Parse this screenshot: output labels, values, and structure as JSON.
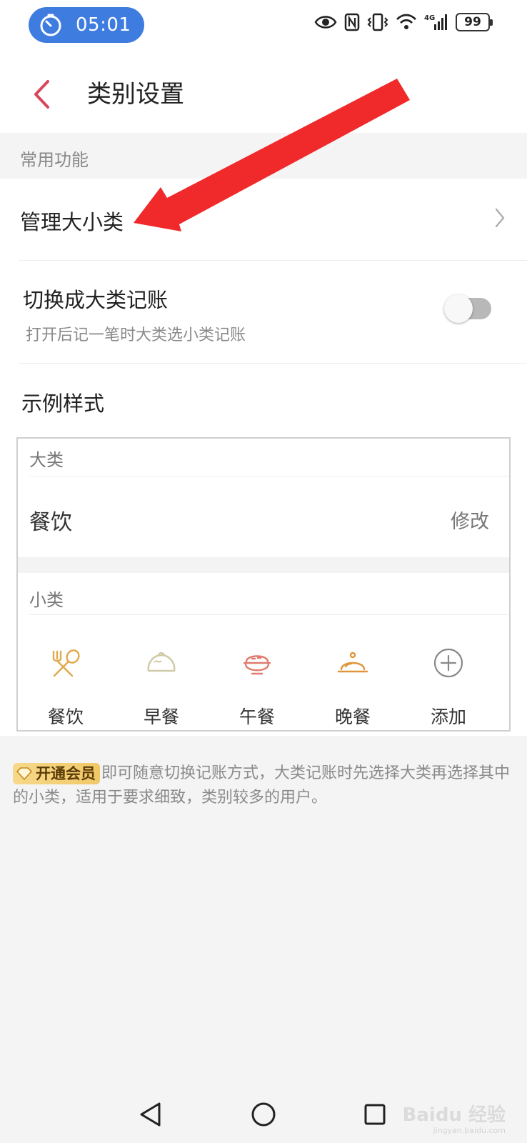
{
  "status_bar": {
    "time": "05:01",
    "battery": "99",
    "signal_label": "4G"
  },
  "header": {
    "title": "类别设置"
  },
  "section": {
    "common_label": "常用功能"
  },
  "settings": {
    "manage_label": "管理大小类",
    "toggle_label": "切换成大类记账",
    "toggle_desc": "打开后记一笔时大类选小类记账",
    "toggle_on": false,
    "example_title": "示例样式"
  },
  "example": {
    "major_label": "大类",
    "major_item": "餐饮",
    "edit_label": "修改",
    "minor_label": "小类",
    "items": [
      {
        "label": "餐饮",
        "icon": "fork-spoon-icon"
      },
      {
        "label": "早餐",
        "icon": "bun-icon"
      },
      {
        "label": "午餐",
        "icon": "rice-bowl-icon"
      },
      {
        "label": "晚餐",
        "icon": "cloche-icon"
      },
      {
        "label": "添加",
        "icon": "add-circle-icon"
      }
    ]
  },
  "note": {
    "badge": "开通会员",
    "text": "即可随意切换记账方式，大类记账时先选择大类再选择其中的小类，适用于要求细致，类别较多的用户。"
  },
  "watermark": {
    "brand": "Baidu 经验",
    "url": "jingyan.baidu.com"
  },
  "colors": {
    "accent": "#d9465a",
    "timer_pill": "#3f7ce0",
    "annotation_arrow": "#f02a2a",
    "icon_gold": "#e0a94a"
  }
}
